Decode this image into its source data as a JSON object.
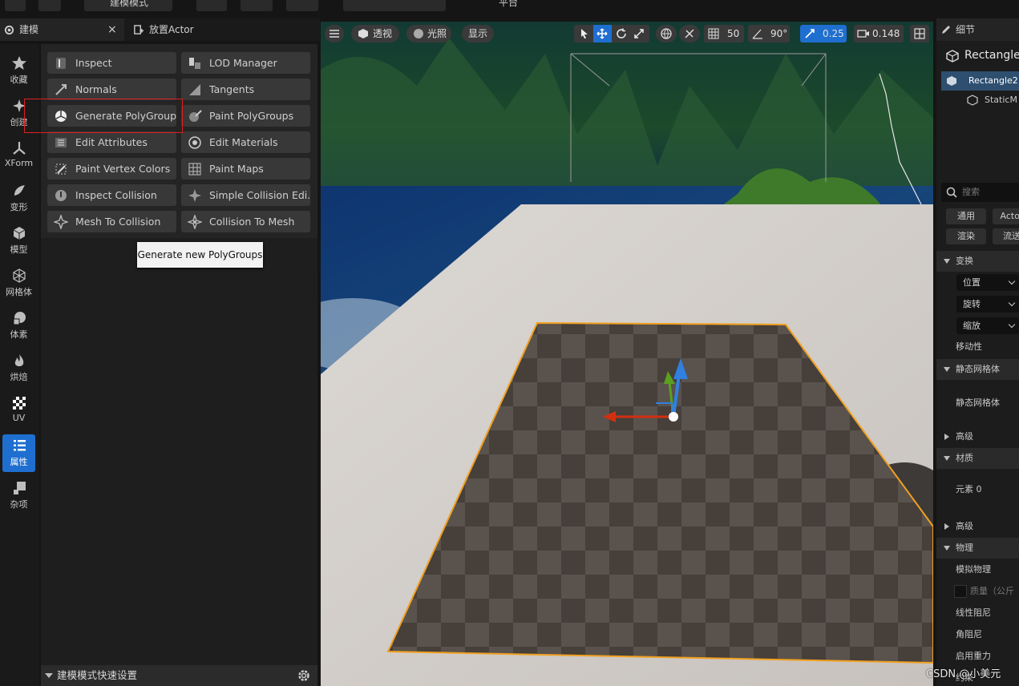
{
  "toolbar": {
    "mode_label": "建模模式",
    "platform_label": "平台"
  },
  "left_tabs": {
    "modeling": "建模",
    "place_actor": "放置Actor",
    "close_glyph": "×"
  },
  "categories": [
    {
      "label": "收藏",
      "icon": "star-icon"
    },
    {
      "label": "创建",
      "icon": "create-icon"
    },
    {
      "label": "XForm",
      "icon": "xform-icon"
    },
    {
      "label": "变形",
      "icon": "deform-icon"
    },
    {
      "label": "模型",
      "icon": "model-icon"
    },
    {
      "label": "网格体",
      "icon": "mesh-icon"
    },
    {
      "label": "体素",
      "icon": "voxel-icon"
    },
    {
      "label": "烘焙",
      "icon": "bake-icon"
    },
    {
      "label": "UV",
      "icon": "uv-icon"
    },
    {
      "label": "属性",
      "icon": "attributes-icon",
      "active": true
    },
    {
      "label": "杂项",
      "icon": "misc-icon"
    }
  ],
  "tools": [
    {
      "label": "Inspect",
      "icon": "inspect-icon"
    },
    {
      "label": "LOD Manager",
      "icon": "lod-manager-icon"
    },
    {
      "label": "Normals",
      "icon": "normals-icon"
    },
    {
      "label": "Tangents",
      "icon": "tangents-icon"
    },
    {
      "label": "Generate PolyGroups",
      "icon": "generate-polygroups-icon",
      "highlighted": true
    },
    {
      "label": "Paint PolyGroups",
      "icon": "paint-polygroups-icon"
    },
    {
      "label": "Edit Attributes",
      "icon": "edit-attributes-icon"
    },
    {
      "label": "Edit Materials",
      "icon": "edit-materials-icon"
    },
    {
      "label": "Paint Vertex Colors",
      "icon": "paint-vertex-colors-icon"
    },
    {
      "label": "Paint Maps",
      "icon": "paint-maps-icon"
    },
    {
      "label": "Inspect Collision",
      "icon": "inspect-collision-icon"
    },
    {
      "label": "Simple Collision Edi...",
      "icon": "simple-collision-icon"
    },
    {
      "label": "Mesh To Collision",
      "icon": "mesh-to-collision-icon"
    },
    {
      "label": "Collision To Mesh",
      "icon": "collision-to-mesh-icon"
    }
  ],
  "tooltip": "Generate new PolyGroups",
  "quick_settings": "建模模式快速设置",
  "viewport": {
    "perspective": "透视",
    "lighting": "光照",
    "show": "显示",
    "grid_snap": "50",
    "rotation_snap": "90°",
    "scale_snap": "0.25",
    "camera_speed": "0.148"
  },
  "details": {
    "title": "细节",
    "actor_name": "Rectangle",
    "outliner_item": "Rectangle2",
    "outliner_child": "StaticM",
    "search_placeholder": "搜索",
    "chips": [
      "通用",
      "Actor",
      "渲染",
      "流送"
    ],
    "sections": {
      "transform": "变换",
      "location": "位置",
      "rotation": "旋转",
      "scale": "缩放",
      "mobility": "移动性",
      "static_mesh": "静态网格体",
      "static_mesh_prop": "静态网格体",
      "advanced": "高级",
      "materials": "材质",
      "element0": "元素 0",
      "advanced2": "高级",
      "physics": "物理",
      "simulate_physics": "模拟物理",
      "mass": "质量（公斤",
      "linear_damping": "线性阻尼",
      "angular_damping": "角阻尼",
      "enable_gravity": "启用重力",
      "constraints": "约束"
    }
  },
  "watermark": "CSDN @小美元",
  "colors": {
    "accent_blue": "#1f6fd0",
    "highlight_red": "#e02020",
    "selection_orange": "#f0a020"
  }
}
